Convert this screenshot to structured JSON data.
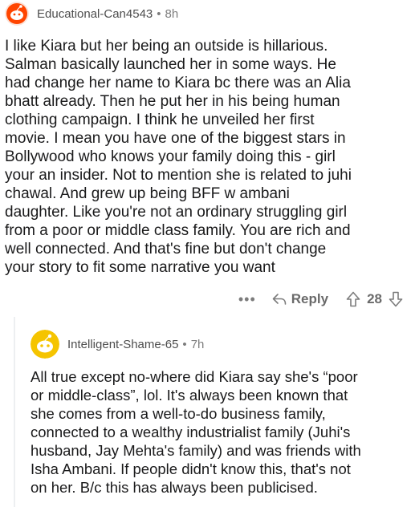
{
  "comments": [
    {
      "username": "Educational-Can4543",
      "separator": "•",
      "time": "8h",
      "text": "I like Kiara but her being an outside is hillarious.\nSalman basically launched her in some ways.  He\nhad change her name to Kiara bc there was an Alia\nbhatt already.  Then he put her in his being human\nclothing campaign.  I think he unveiled her first\nmovie.   I mean you have one of the biggest stars in\nBollywood who knows your family doing this - girl\nyour an insider.  Not to mention she is related to juhi\nchawal.   And grew up being BFF w ambani\ndaughter.  Like you're not an ordinary struggling girl\nfrom a poor or middle class family.  You are rich and\nwell connected.   And that's fine but don't change\nyour story to fit some narrative you want",
      "actions": {
        "more_label": "•••",
        "reply_label": "Reply",
        "score": "28"
      },
      "avatar_color": "#ff4500"
    },
    {
      "username": "Intelligent-Shame-65",
      "separator": "•",
      "time": "7h",
      "text": "All true except no-where did Kiara say she's “poor\nor middle-class”, lol. It's always been known that\nshe comes from a well-to-do business family,\nconnected to a wealthy industrialist family (Juhi's\nhusband, Jay Mehta's family) and was friends with\nIsha Ambani. If people didn't know this, that's not\non her. B/c this has always been publicised.",
      "avatar_color": "#f5c400"
    }
  ],
  "colors": {
    "text": "#1a1a1b",
    "meta": "#7c7c7c",
    "thread_line": "#edeff1"
  }
}
